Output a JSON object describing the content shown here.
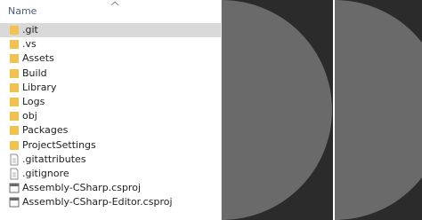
{
  "header": {
    "name_column": "Name"
  },
  "files": [
    {
      "name": ".git",
      "type": "folder",
      "selected": true
    },
    {
      "name": ".vs",
      "type": "folder"
    },
    {
      "name": "Assets",
      "type": "folder"
    },
    {
      "name": "Build",
      "type": "folder"
    },
    {
      "name": "Library",
      "type": "folder"
    },
    {
      "name": "Logs",
      "type": "folder"
    },
    {
      "name": "obj",
      "type": "folder"
    },
    {
      "name": "Packages",
      "type": "folder"
    },
    {
      "name": "ProjectSettings",
      "type": "folder"
    },
    {
      "name": ".gitattributes",
      "type": "file"
    },
    {
      "name": ".gitignore",
      "type": "file"
    },
    {
      "name": "Assembly-CSharp.csproj",
      "type": "project-file"
    },
    {
      "name": "Assembly-CSharp-Editor.csproj",
      "type": "project-file"
    }
  ],
  "colors": {
    "folder": "#f2c14e",
    "selected_row": "#d9d9d9",
    "panel_background": "#2b2b2b",
    "circle_fill": "#6a6a6a"
  }
}
